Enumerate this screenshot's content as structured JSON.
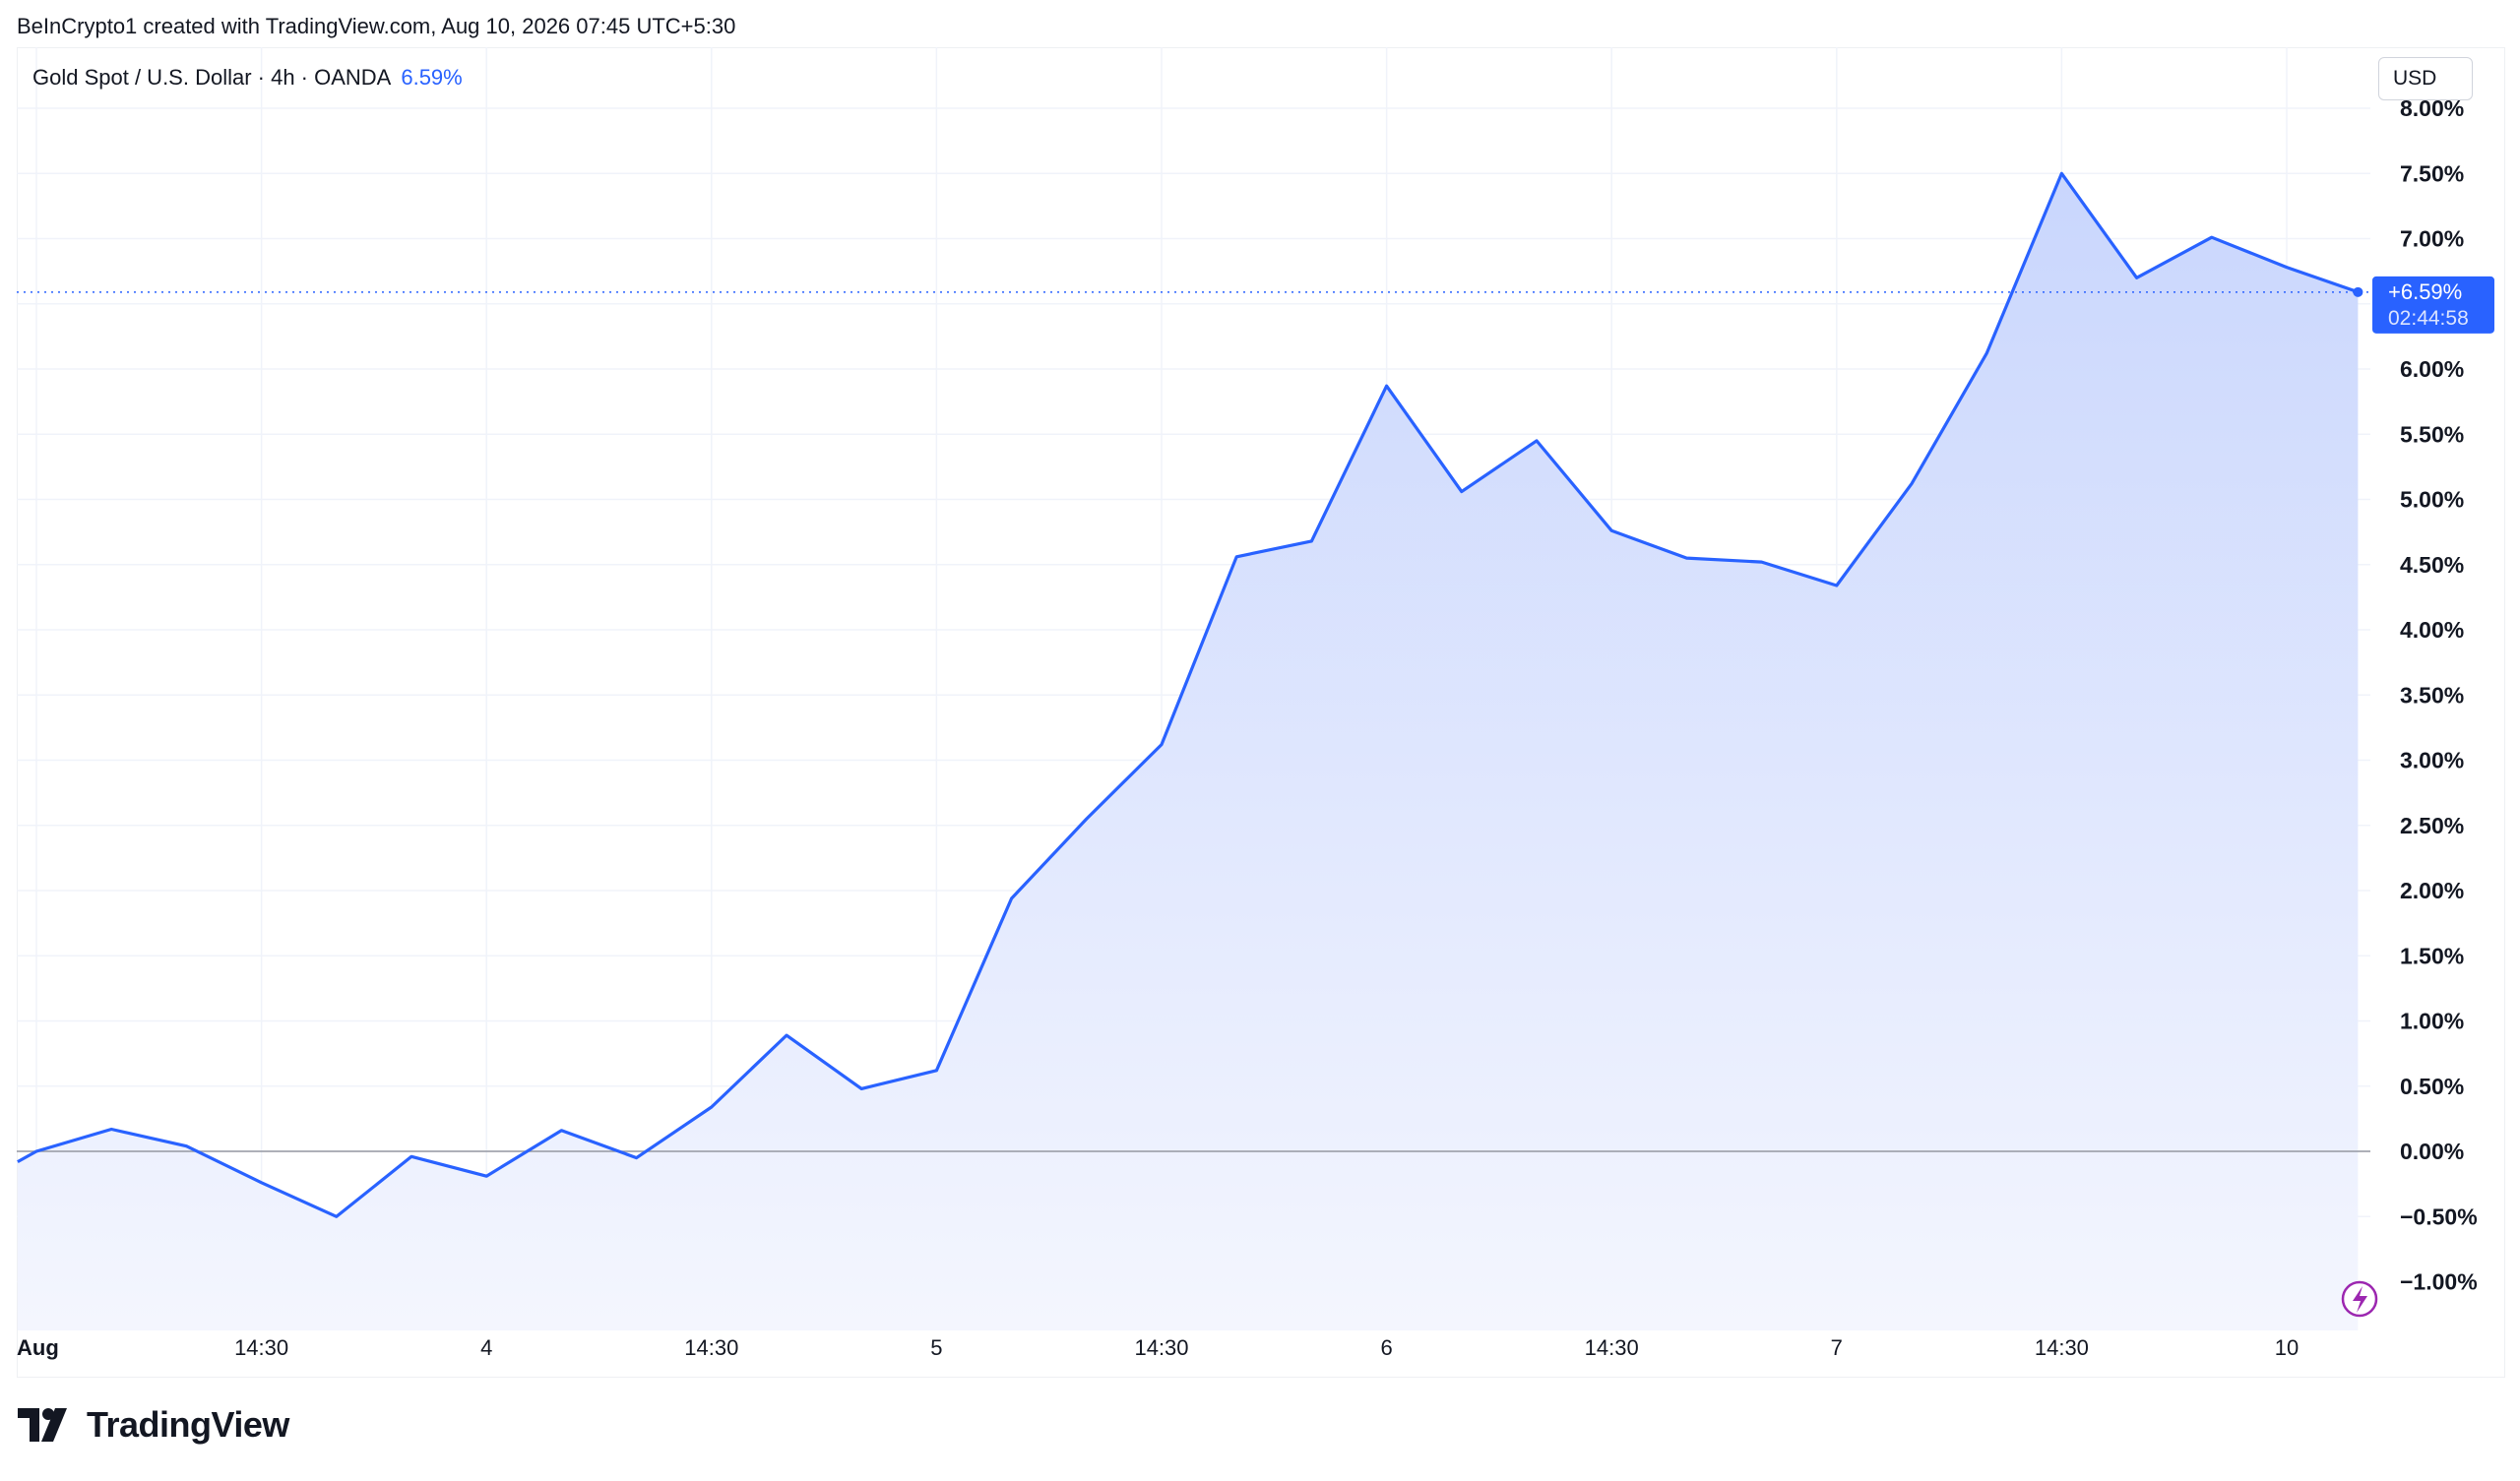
{
  "credit": "BeInCrypto1 created with TradingView.com, Aug 10, 2026 07:45 UTC+5:30",
  "legend": {
    "symbol": "Gold Spot / U.S. Dollar · 4h · OANDA",
    "change": "6.59%"
  },
  "currency_button": "USD",
  "price_tag": {
    "value": "+6.59%",
    "countdown": "02:44:58"
  },
  "brand": {
    "name": "TradingView",
    "icon": "tradingview-logo-icon"
  },
  "flash_icon": "lightning-icon",
  "colors": {
    "line": "#2962ff",
    "fill_top": "#c9d6fd",
    "fill_bottom": "#f4f6fe",
    "zero_line": "#9598a1",
    "grid": "#f0f3fa"
  },
  "chart_data": {
    "type": "area",
    "title": "",
    "xlabel": "",
    "ylabel": "",
    "x_tick_labels": [
      {
        "label": "Aug",
        "index": 0.0,
        "bold": true
      },
      {
        "label": "14:30",
        "index": 3.0,
        "bold": false
      },
      {
        "label": "4",
        "index": 6.0,
        "bold": false
      },
      {
        "label": "14:30",
        "index": 9.0,
        "bold": false
      },
      {
        "label": "5",
        "index": 12.0,
        "bold": false
      },
      {
        "label": "14:30",
        "index": 15.0,
        "bold": false
      },
      {
        "label": "6",
        "index": 18.0,
        "bold": false
      },
      {
        "label": "14:30",
        "index": 21.0,
        "bold": false
      },
      {
        "label": "7",
        "index": 24.0,
        "bold": false
      },
      {
        "label": "14:30",
        "index": 27.0,
        "bold": false
      },
      {
        "label": "10",
        "index": 30.0,
        "bold": false
      }
    ],
    "y_ticks": [
      8.0,
      7.5,
      7.0,
      6.5,
      6.0,
      5.5,
      5.0,
      4.5,
      4.0,
      3.5,
      3.0,
      2.5,
      2.0,
      1.5,
      1.0,
      0.5,
      0.0,
      -0.5,
      -1.0
    ],
    "y_tick_labels": [
      "8.00%",
      "7.50%",
      "7.00%",
      "6.50%",
      "6.00%",
      "5.50%",
      "5.00%",
      "4.50%",
      "4.00%",
      "3.50%",
      "3.00%",
      "2.50%",
      "2.00%",
      "1.50%",
      "1.00%",
      "0.50%",
      "0.00%",
      "−0.50%",
      "−1.00%"
    ],
    "ylim": [
      -1.0,
      8.0
    ],
    "xlim": [
      -0.25,
      31.0
    ],
    "grid": true,
    "baseline": 0.0,
    "last_value": 6.59,
    "series": [
      {
        "x": [
          -0.25,
          0,
          1,
          2,
          3,
          4,
          5,
          6,
          7,
          8,
          9,
          10,
          11,
          12,
          13,
          14,
          15,
          16,
          17,
          18,
          19,
          20,
          21,
          22,
          23,
          24,
          25,
          26,
          27,
          28,
          29,
          30,
          30.95
        ],
        "values": [
          -0.08,
          0.0,
          0.17,
          0.04,
          -0.24,
          -0.5,
          -0.04,
          -0.19,
          0.16,
          -0.05,
          0.34,
          0.89,
          0.48,
          0.62,
          1.94,
          2.55,
          3.12,
          4.56,
          4.68,
          5.87,
          5.06,
          5.45,
          4.76,
          4.55,
          4.52,
          4.34,
          5.12,
          6.12,
          7.5,
          6.7,
          7.01,
          6.78,
          6.59
        ]
      }
    ]
  }
}
